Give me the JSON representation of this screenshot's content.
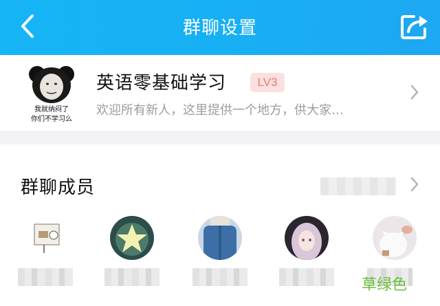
{
  "header": {
    "title": "群聊设置",
    "background_color": "#16b5f5",
    "back_icon": "chevron-left-icon",
    "share_icon": "share-icon"
  },
  "group": {
    "name": "英语零基础学习",
    "level": "LV3",
    "description": "欢迎所有新人，这里提供一个地方，供大家…",
    "avatar_caption_line1": "我就纳闷了",
    "avatar_caption_line2": "你们不学习么"
  },
  "members": {
    "title": "群聊成员",
    "list": [
      {
        "avatar": "cartoon-sign-avatar"
      },
      {
        "avatar": "glowing-star-avatar"
      },
      {
        "avatar": "denim-shirt-avatar"
      },
      {
        "avatar": "anime-girl-avatar"
      },
      {
        "avatar": "anime-cat-avatar"
      }
    ]
  },
  "watermark": {
    "text": "草绿色",
    "color": "#6cbf3a"
  }
}
